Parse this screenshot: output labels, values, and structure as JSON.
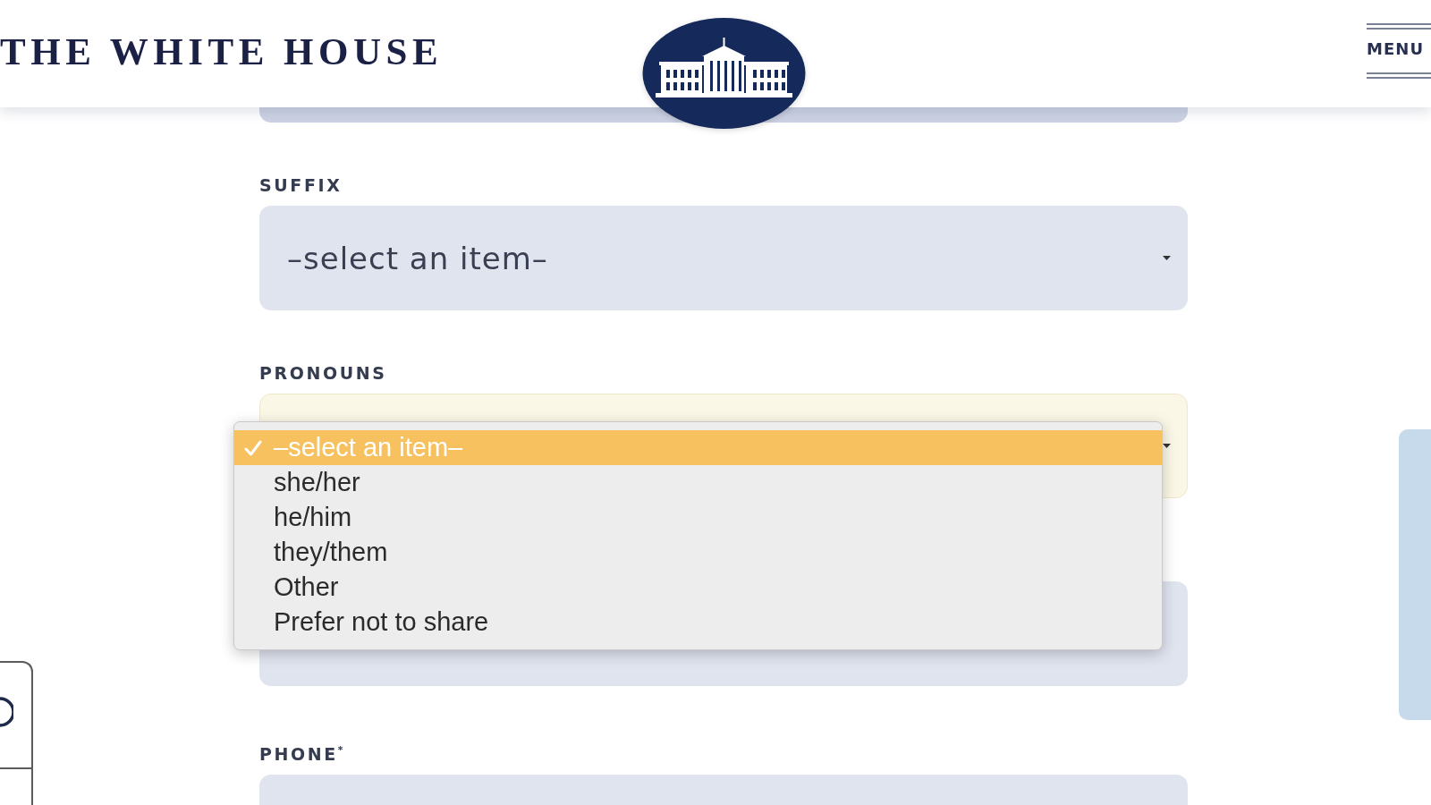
{
  "header": {
    "title": "THE WHITE HOUSE",
    "menu_button": "MENU"
  },
  "form": {
    "fields": [
      {
        "kind": "partial",
        "focused": false
      },
      {
        "kind": "select",
        "label": "SUFFIX",
        "value": "–select an item–",
        "focused": false
      },
      {
        "kind": "select",
        "label": "PRONOUNS",
        "focused": true,
        "expanded": true,
        "options": [
          {
            "label": "–select an item–",
            "selected": true
          },
          {
            "label": "she/her",
            "selected": false
          },
          {
            "label": "he/him",
            "selected": false
          },
          {
            "label": "they/them",
            "selected": false
          },
          {
            "label": "Other",
            "selected": false
          },
          {
            "label": "Prefer not to share",
            "selected": false
          }
        ]
      },
      {
        "kind": "text",
        "focused": false
      },
      {
        "kind": "text",
        "label": "PHONE$^{*}$",
        "focused": false
      }
    ]
  }
}
